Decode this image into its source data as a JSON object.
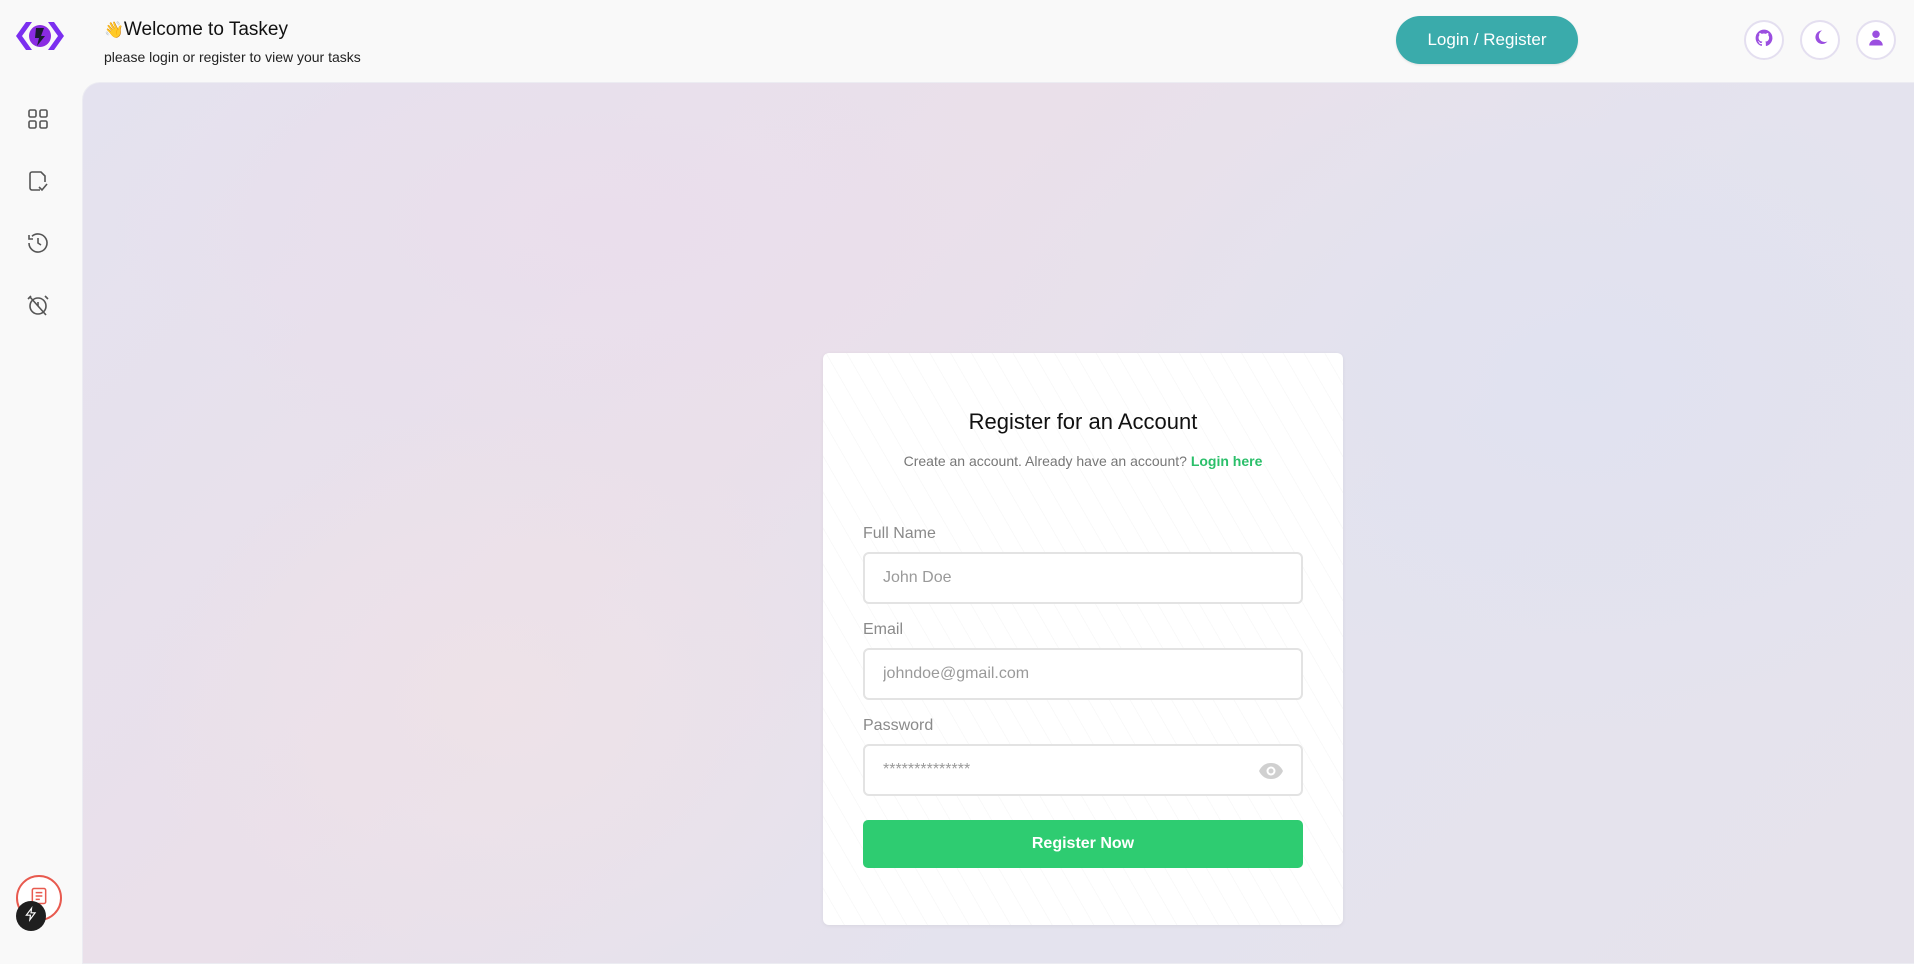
{
  "header": {
    "logo_icon": "taskey-logo-icon",
    "wave_emoji": "👋",
    "title": "Welcome to Taskey",
    "subtitle": "please login or register to view your tasks",
    "login_register_label": "Login / Register",
    "github_icon": "github-icon",
    "theme_icon": "moon-icon",
    "profile_icon": "user-icon"
  },
  "sidebar": {
    "items": [
      {
        "icon": "dashboard-grid-icon"
      },
      {
        "icon": "task-check-icon"
      },
      {
        "icon": "history-clock-icon"
      },
      {
        "icon": "timer-off-icon"
      }
    ],
    "feedback_icon": "feedback-icon",
    "bolt_icon": "bolt-icon"
  },
  "form": {
    "title": "Register for an Account",
    "subtitle_text": "Create an account. Already have an account?",
    "login_link": "Login here",
    "full_name_label": "Full Name",
    "full_name_placeholder": "John Doe",
    "email_label": "Email",
    "email_placeholder": "johndoe@gmail.com",
    "password_label": "Password",
    "password_placeholder": "**************",
    "eye_icon": "eye-icon",
    "submit_label": "Register Now"
  },
  "colors": {
    "accent_teal": "#3aabab",
    "accent_purple": "#9b4fe0",
    "accent_green": "#2ecc71",
    "link_green": "#2bbf6a"
  }
}
